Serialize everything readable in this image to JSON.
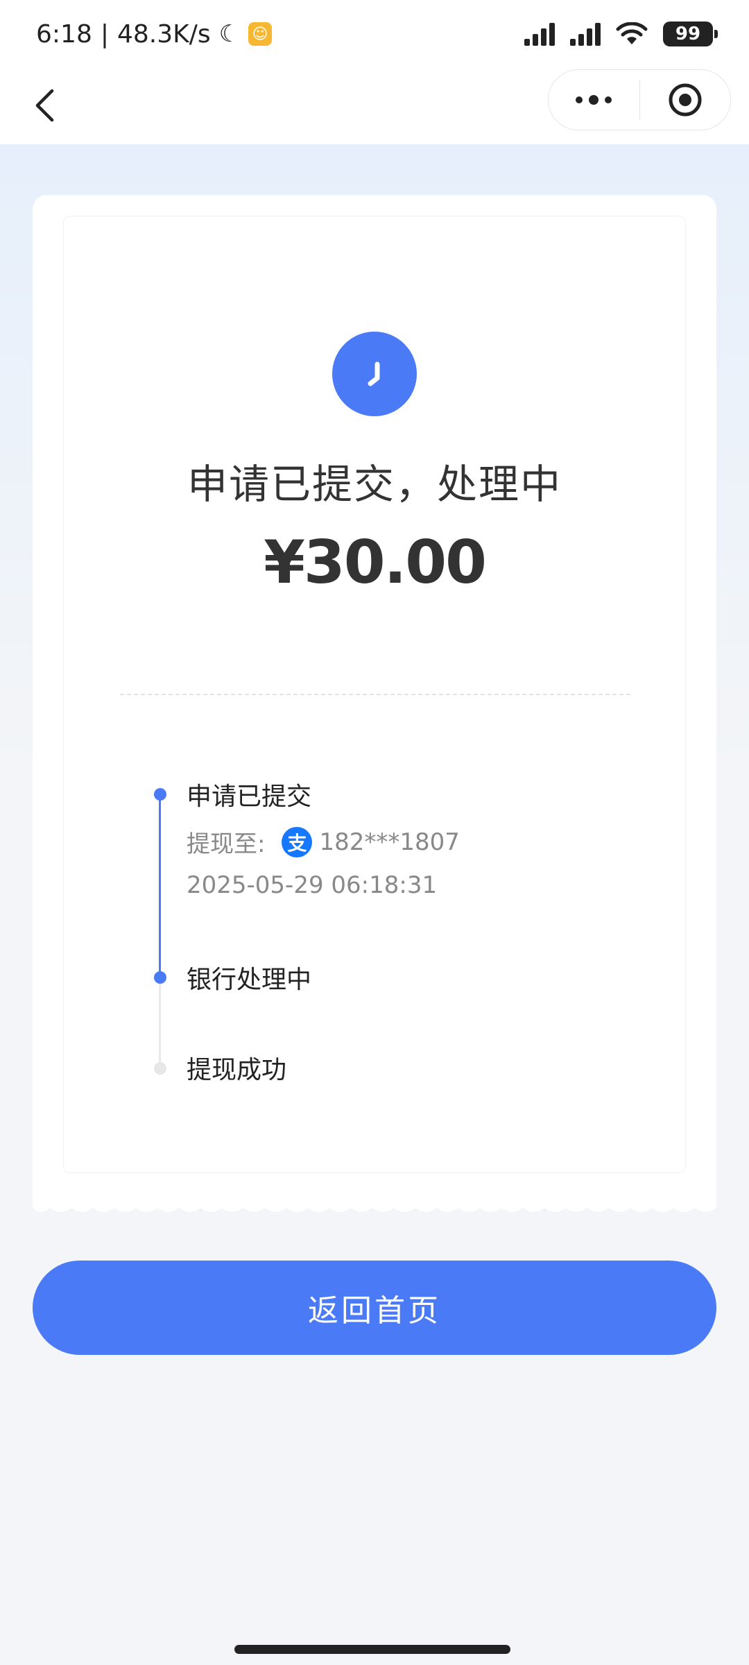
{
  "status_bar": {
    "time": "6:18",
    "separator": "|",
    "network_speed": "48.3K/s",
    "battery": "99",
    "icons": [
      "moon-icon",
      "app-notification-icon",
      "signal-icon",
      "signal-icon",
      "wifi-icon",
      "battery-icon"
    ]
  },
  "nav": {
    "back_icon": "chevron-left-icon",
    "more_icon": "more-dots-icon",
    "close_icon": "target-circle-icon"
  },
  "status": {
    "icon": "clock-icon",
    "title": "申请已提交，处理中",
    "amount": "¥30.00"
  },
  "timeline": {
    "steps": [
      {
        "title": "申请已提交",
        "withdraw_label": "提现至:",
        "account_icon": "alipay-icon",
        "account": "182***1807",
        "time": "2025-05-29 06:18:31",
        "state": "done"
      },
      {
        "title": "银行处理中",
        "state": "current"
      },
      {
        "title": "提现成功",
        "state": "pending"
      }
    ]
  },
  "actions": {
    "home_label": "返回首页"
  },
  "colors": {
    "accent": "#4a7af5",
    "alipay": "#1677ff"
  }
}
